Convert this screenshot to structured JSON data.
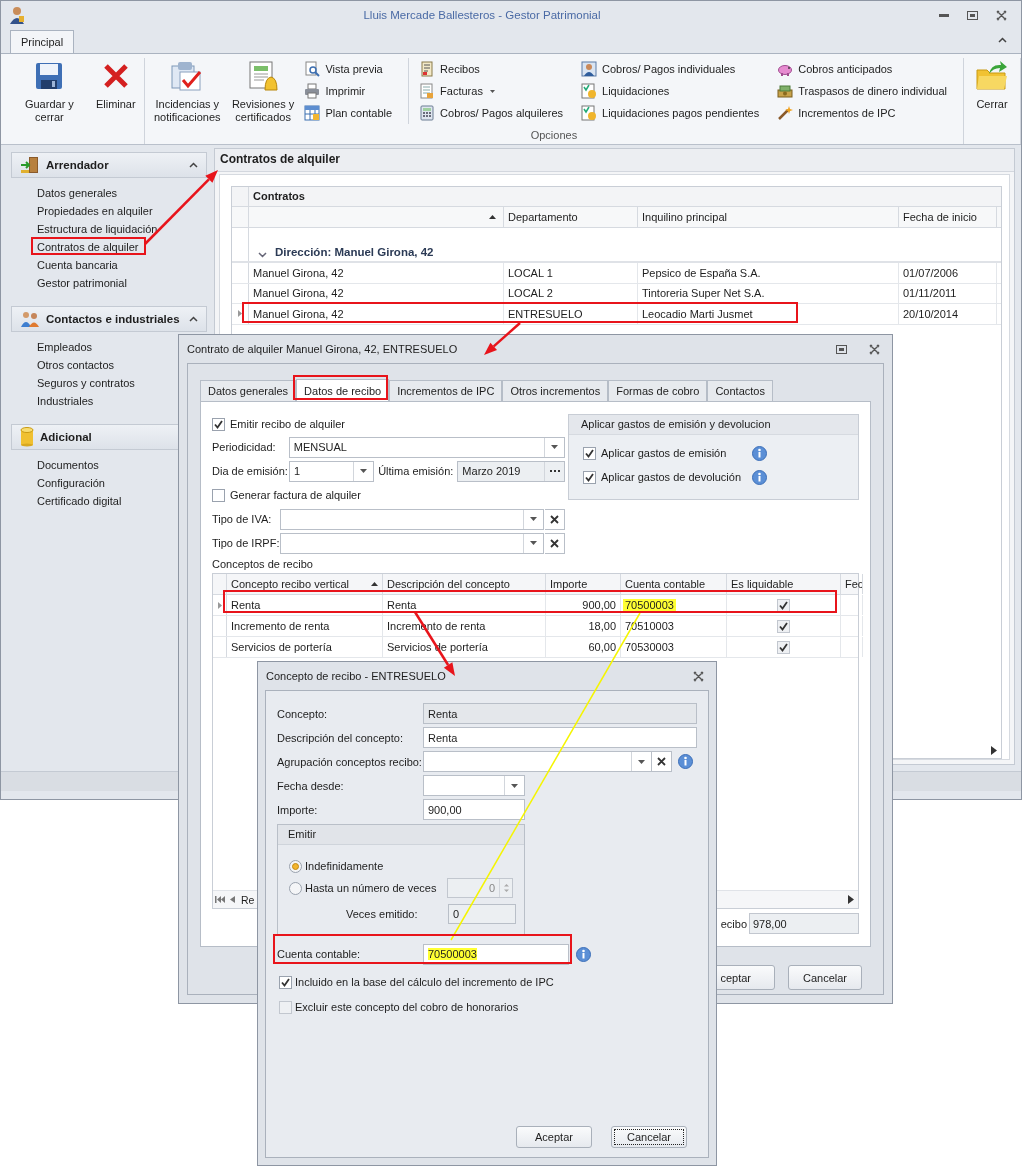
{
  "window": {
    "title": "Lluis Mercade Ballesteros - Gestor Patrimonial"
  },
  "ribbon": {
    "tabs": [
      {
        "label": "Principal",
        "selected": true
      }
    ],
    "groups": [
      {
        "items": [
          {
            "kind": "large",
            "label": "Guardar y cerrar"
          },
          {
            "kind": "large",
            "label": "Eliminar"
          }
        ]
      },
      {
        "label": "Opciones",
        "items": [
          {
            "kind": "large",
            "label": "Incidencias y notificaciones"
          },
          {
            "kind": "large",
            "label": "Revisiones y certificados"
          },
          {
            "kind": "column",
            "buttons": [
              {
                "label": "Vista previa",
                "dropdown": false
              },
              {
                "label": "Imprimir",
                "dropdown": false
              },
              {
                "label": "Plan contable",
                "dropdown": false
              }
            ]
          },
          {
            "kind": "column",
            "buttons": [
              {
                "label": "Recibos",
                "dropdown": false
              },
              {
                "label": "Facturas",
                "dropdown": true
              },
              {
                "label": "Cobros/ Pagos alquileres",
                "dropdown": false
              }
            ]
          },
          {
            "kind": "column",
            "buttons": [
              {
                "label": "Cobros/ Pagos individuales",
                "dropdown": false
              },
              {
                "label": "Liquidaciones",
                "dropdown": false
              },
              {
                "label": "Liquidaciones pagos pendientes",
                "dropdown": false
              }
            ]
          },
          {
            "kind": "column",
            "buttons": [
              {
                "label": "Cobros anticipados",
                "dropdown": false
              },
              {
                "label": "Traspasos de dinero individual",
                "dropdown": false
              },
              {
                "label": "Incrementos de IPC",
                "dropdown": false
              }
            ]
          }
        ]
      },
      {
        "items": [
          {
            "kind": "large",
            "label": "Cerrar"
          }
        ]
      }
    ]
  },
  "sidebar": {
    "sections": [
      {
        "title": "Arrendador",
        "items": [
          "Datos generales",
          "Propiedades en alquiler",
          "Estructura de liquidación",
          "Contratos de alquiler",
          "Cuenta bancaria",
          "Gestor patrimonial"
        ]
      },
      {
        "title": "Contactos e industriales",
        "items": [
          "Empleados",
          "Otros contactos",
          "Seguros y contratos",
          "Industriales"
        ]
      },
      {
        "title": "Adicional",
        "items": [
          "Documentos",
          "Configuración",
          "Certificado digital"
        ]
      }
    ]
  },
  "content": {
    "title": "Contratos de alquiler",
    "grid": {
      "title": "Contratos",
      "columns": [
        {
          "sorted": true
        },
        {
          "label": "Departamento",
          "sorted": false
        },
        {
          "label": "Inquilino principal",
          "sorted": false
        },
        {
          "label": "Fecha de inicio",
          "sorted": false
        }
      ],
      "group_row": {
        "label": "Dirección: Manuel Girona, 42",
        "expanded": true
      },
      "rows": [
        {
          "cells": [
            "Manuel Girona, 42",
            "LOCAL 1",
            "Pepsico de España S.A.",
            "01/07/2006"
          ],
          "selected": false
        },
        {
          "cells": [
            "Manuel Girona, 42",
            "LOCAL 2",
            "Tintoreria Super Net S.A.",
            "01/11/2011"
          ],
          "selected": false
        },
        {
          "cells": [
            "Manuel Girona, 42",
            "ENTRESUELO",
            "Leocadio Marti Jusmet",
            "20/10/2014"
          ],
          "selected": true
        }
      ]
    }
  },
  "contract_dialog": {
    "title": "Contrato de alquiler Manuel Girona, 42, ENTRESUELO",
    "tabs": [
      {
        "label": "Datos generales",
        "selected": false
      },
      {
        "label": "Datos de recibo",
        "selected": true
      },
      {
        "label": "Incrementos de IPC",
        "selected": false
      },
      {
        "label": "Otros incrementos",
        "selected": false
      },
      {
        "label": "Formas de cobro",
        "selected": false
      },
      {
        "label": "Contactos",
        "selected": false
      }
    ],
    "emitir": {
      "label": "Emitir recibo de alquiler",
      "checked": true
    },
    "periodicidad": {
      "label": "Periodicidad:",
      "value": "MENSUAL"
    },
    "dia_emision": {
      "label": "Dia de emisión:",
      "value": "1"
    },
    "ultima_emision": {
      "label": "Última emisión:",
      "value": "Marzo 2019"
    },
    "generar_factura": {
      "label": "Generar factura de alquiler",
      "checked": false
    },
    "tipo_iva": {
      "label": "Tipo de IVA:"
    },
    "tipo_irpf": {
      "label": "Tipo de IRPF:"
    },
    "gastos": {
      "title": "Aplicar gastos de emisión y devolucion",
      "options": [
        {
          "label": "Aplicar gastos de emisión",
          "checked": true
        },
        {
          "label": "Aplicar gastos de devolución",
          "checked": true
        }
      ]
    },
    "conceptos": {
      "title": "Conceptos de recibo",
      "columns": [
        {
          "label": "Concepto recibo vertical",
          "sorted": true
        },
        {
          "label": "Descripción del concepto",
          "sorted": false
        },
        {
          "label": "Importe",
          "sorted": false
        },
        {
          "label": "Cuenta contable",
          "sorted": false
        },
        {
          "label": "Es liquidable",
          "sorted": false
        },
        {
          "label": "Fec",
          "sorted": false
        }
      ],
      "rows": [
        {
          "concepto": "Renta",
          "descripcion": "Renta",
          "importe": "900,00",
          "cuenta": "70500003",
          "cuenta_highlighted": true,
          "liquidable": true,
          "selected": true
        },
        {
          "concepto": "Incremento de renta",
          "descripcion": "Incremento de renta",
          "importe": "18,00",
          "cuenta": "70510003",
          "cuenta_highlighted": false,
          "liquidable": true,
          "selected": false
        },
        {
          "concepto": "Servicios de portería",
          "descripcion": "Servicios de portería",
          "importe": "60,00",
          "cuenta": "70530003",
          "cuenta_highlighted": false,
          "liquidable": true,
          "selected": false
        }
      ],
      "navigator_text": "Re"
    },
    "total": {
      "label": "ecibo",
      "value": "978,00"
    },
    "buttons": [
      "ceptar",
      "Cancelar"
    ]
  },
  "concept_dialog": {
    "title": "Concepto de recibo - ENTRESUELO",
    "concepto": {
      "label": "Concepto:",
      "value": "Renta"
    },
    "descripcion": {
      "label": "Descripción del concepto:",
      "value": "Renta"
    },
    "agrupacion": {
      "label": "Agrupación conceptos recibo:"
    },
    "fecha_desde": {
      "label": "Fecha desde:"
    },
    "importe": {
      "label": "Importe:",
      "value": "900,00"
    },
    "emitir": {
      "title": "Emitir",
      "options": [
        {
          "label": "Indefinidamente",
          "selected": true
        },
        {
          "label": "Hasta un número de veces",
          "selected": false
        }
      ],
      "veces_value": "0",
      "veces_emitido": {
        "label": "Veces emitido:",
        "value": "0"
      }
    },
    "cuenta_contable": {
      "label": "Cuenta contable:",
      "value": "70500003",
      "highlighted": true
    },
    "checks": [
      {
        "label": "Incluido en la base del cálculo del incremento de IPC",
        "checked": true
      },
      {
        "label": "Excluir este concepto del cobro de honorarios",
        "checked": false
      }
    ],
    "buttons": [
      {
        "label": "Aceptar",
        "focused": false
      },
      {
        "label": "Cancelar",
        "focused": true
      }
    ]
  }
}
